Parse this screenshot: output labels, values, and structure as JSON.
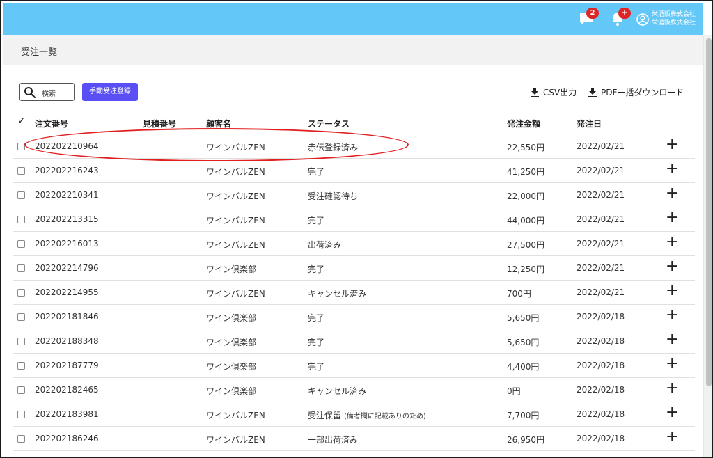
{
  "header": {
    "chat_badge": "2",
    "bell_badge": "+",
    "company_line1": "栄酒販株式会社",
    "company_line2": "栄酒販株式会社",
    "icons": [
      "chat-icon",
      "bell-icon",
      "user-circle-icon"
    ],
    "color": "#63c7f7"
  },
  "page": {
    "title": "受注一覧"
  },
  "toolbar": {
    "search_placeholder": "検索",
    "add_order_label": "手動受注登録",
    "csv_label": "CSV出力",
    "pdf_label": "PDF一括ダウンロード",
    "accent": "#5a4ff5"
  },
  "table": {
    "headers": {
      "check": "✓",
      "order_no": "注文番号",
      "estimate_no": "見積番号",
      "customer": "顧客名",
      "status": "ステータス",
      "amount": "発注金額",
      "date": "発注日"
    },
    "rows": [
      {
        "order_no": "202202210964",
        "estimate_no": "",
        "customer": "ワインバルZEN",
        "status": "赤伝登録済み",
        "status_note": "",
        "amount": "22,550円",
        "date": "2022/02/21",
        "highlighted": true
      },
      {
        "order_no": "202202216243",
        "estimate_no": "",
        "customer": "ワインバルZEN",
        "status": "完了",
        "status_note": "",
        "amount": "41,250円",
        "date": "2022/02/21"
      },
      {
        "order_no": "202202210341",
        "estimate_no": "",
        "customer": "ワインバルZEN",
        "status": "受注確認待ち",
        "status_note": "",
        "amount": "22,000円",
        "date": "2022/02/21"
      },
      {
        "order_no": "202202213315",
        "estimate_no": "",
        "customer": "ワインバルZEN",
        "status": "完了",
        "status_note": "",
        "amount": "44,000円",
        "date": "2022/02/21"
      },
      {
        "order_no": "202202216013",
        "estimate_no": "",
        "customer": "ワインバルZEN",
        "status": "出荷済み",
        "status_note": "",
        "amount": "27,500円",
        "date": "2022/02/21"
      },
      {
        "order_no": "202202214796",
        "estimate_no": "",
        "customer": "ワイン倶楽部",
        "status": "完了",
        "status_note": "",
        "amount": "12,250円",
        "date": "2022/02/21"
      },
      {
        "order_no": "202202214955",
        "estimate_no": "",
        "customer": "ワインバルZEN",
        "status": "キャンセル済み",
        "status_note": "",
        "amount": "700円",
        "date": "2022/02/21"
      },
      {
        "order_no": "202202181846",
        "estimate_no": "",
        "customer": "ワイン倶楽部",
        "status": "完了",
        "status_note": "",
        "amount": "5,650円",
        "date": "2022/02/18"
      },
      {
        "order_no": "202202188348",
        "estimate_no": "",
        "customer": "ワイン倶楽部",
        "status": "完了",
        "status_note": "",
        "amount": "5,650円",
        "date": "2022/02/18"
      },
      {
        "order_no": "202202187779",
        "estimate_no": "",
        "customer": "ワイン倶楽部",
        "status": "完了",
        "status_note": "",
        "amount": "4,400円",
        "date": "2022/02/18"
      },
      {
        "order_no": "202202182465",
        "estimate_no": "",
        "customer": "ワイン倶楽部",
        "status": "キャンセル済み",
        "status_note": "",
        "amount": "0円",
        "date": "2022/02/18"
      },
      {
        "order_no": "202202183981",
        "estimate_no": "",
        "customer": "ワインバルZEN",
        "status": "受注保留",
        "status_note": "(備考欄に記載ありのため)",
        "amount": "7,700円",
        "date": "2022/02/18"
      },
      {
        "order_no": "202202186246",
        "estimate_no": "",
        "customer": "ワインバルZEN",
        "status": "一部出荷済み",
        "status_note": "",
        "amount": "26,950円",
        "date": "2022/02/18"
      }
    ],
    "expand_icon": "plus-icon"
  }
}
